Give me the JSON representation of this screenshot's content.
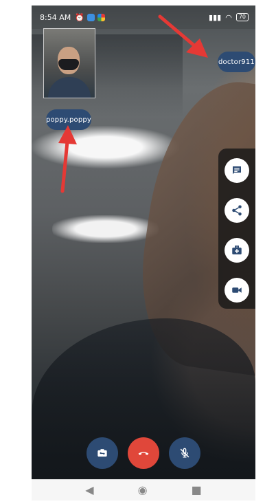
{
  "status_bar": {
    "time": "8:54 AM",
    "battery": "70"
  },
  "participants": {
    "self_label": "poppy.poppy",
    "remote_label": "doctor911"
  },
  "side_actions": [
    {
      "name": "chat",
      "icon": "chat-icon"
    },
    {
      "name": "share",
      "icon": "share-icon"
    },
    {
      "name": "medical",
      "icon": "medical-kit-icon"
    },
    {
      "name": "video",
      "icon": "video-camera-icon"
    }
  ],
  "call_controls": [
    {
      "name": "switch-camera",
      "icon": "switch-camera-icon",
      "color": "#2d4b73"
    },
    {
      "name": "end-call",
      "icon": "phone-hangup-icon",
      "color": "#e0473a"
    },
    {
      "name": "mute",
      "icon": "mic-off-icon",
      "color": "#2d4b73"
    }
  ],
  "colors": {
    "pill": "#2d4b73",
    "end_call": "#e0473a",
    "annotation_arrow": "#e53935"
  }
}
